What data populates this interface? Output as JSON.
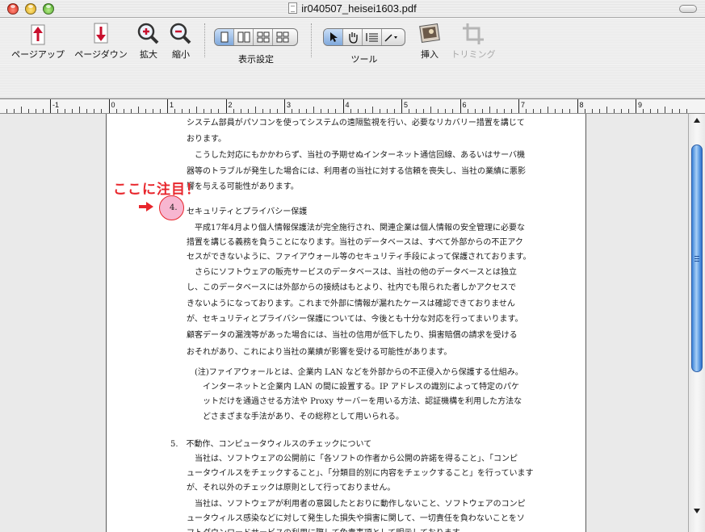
{
  "window": {
    "title": "ir040507_heisei1603.pdf"
  },
  "toolbar": {
    "page_up": "ページアップ",
    "page_down": "ページダウン",
    "zoom_in": "拡大",
    "zoom_out": "縮小",
    "display_settings": "表示設定",
    "tools": "ツール",
    "insert": "挿入",
    "trimming": "トリミング"
  },
  "ruler": {
    "labels": [
      "-1",
      "0",
      "1",
      "2",
      "3",
      "4",
      "5",
      "6",
      "7",
      "8",
      "9"
    ]
  },
  "annotation": {
    "text": "ここに注目！",
    "number": "4."
  },
  "document": {
    "lines": [
      "システム部員がパソコンを使ってシステムの遠隔監視を行い、必要なリカバリー措置を講じて",
      "おります。",
      "　こうした対応にもかかわらず、当社の予期せぬインターネット通信回線、あるいはサーバ機",
      "器等のトラブルが発生した場合には、利用者の当社に対する信頼を喪失し、当社の業績に悪影",
      "響を与える可能性があります。",
      "セキュリティとプライバシー保護",
      "　平成17年4月より個人情報保護法が完全施行され、関連企業は個人情報の安全管理に必要な",
      "措置を講じる義務を負うことになります。当社のデータベースは、すべて外部からの不正アク",
      "セスができないように、ファイアウォール等のセキュリティ手段によって保護されております。",
      "　さらにソフトウェアの販売サービスのデータベースは、当社の他のデータベースとは独立",
      "し、このデータベースには外部からの接続はもとより、社内でも限られた者しかアクセスで",
      "きないようになっております。これまで外部に情報が漏れたケースは確認できておりません",
      "が、セキュリティとプライバシー保護については、今後とも十分な対応を行ってまいります。",
      "顧客データの漏洩等があった場合には、当社の信用が低下したり、損害賠償の請求を受ける",
      "おそれがあり、これにより当社の業績が影響を受ける可能性があります。",
      "(注)ファイアウォールとは、企業内 LAN などを外部からの不正侵入から保護する仕組み。",
      "インターネットと企業内 LAN の間に設置する。IP アドレスの識別によって特定のパケ",
      "ットだけを通過させる方法や Proxy サーバーを用いる方法、認証機構を利用した方法な",
      "どさまざまな手法があり、その総称として用いられる。",
      "5.　不動作、コンピュータウィルスのチェックについて",
      "　当社は、ソフトウェアの公開前に「各ソフトの作者から公開の許諾を得ること」、「コンピ",
      "ュータウイルスをチェックすること」、「分類目的別に内容をチェックすること」を行っています",
      "が、それ以外のチェックは原則として行っておりません。",
      "　当社は、ソフトウェアが利用者の意図したとおりに動作しないこと、ソフトウェアのコンピ",
      "ュータウィルス感染などに対して発生した損失や損害に関して、一切責任を負わないことをソ",
      "フトダウンロードサービスの利用に際して免責事項として明示しております。"
    ]
  },
  "colors": {
    "annotation_red": "#e8262c",
    "highlight_pink": "#f7b6d0",
    "scroll_blue": "#3b82d8"
  }
}
